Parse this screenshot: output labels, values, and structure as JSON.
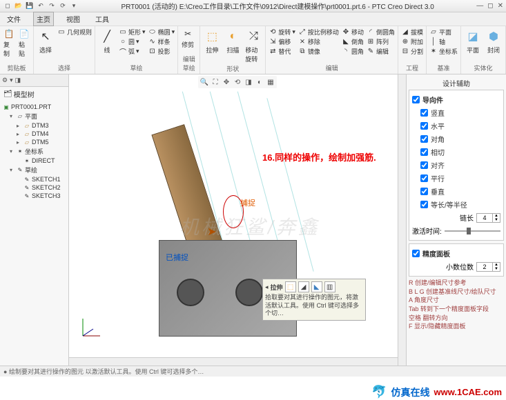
{
  "titlebar": {
    "title": "PRT0001 (活动的) E:\\Creo工作目录\\工作文件\\0912\\Direct建模操作\\prt0001.prt.6 - PTC Creo Direct 3.0"
  },
  "menubar": {
    "items": [
      "文件",
      "主页",
      "视图",
      "工具"
    ],
    "active_index": 1
  },
  "ribbon": {
    "groups": [
      {
        "label": "剪贴板",
        "items": [
          "复制",
          "粘贴"
        ]
      },
      {
        "label": "选择",
        "items": [
          "选择",
          "几何规则"
        ]
      },
      {
        "label": "草绘",
        "items": [
          {
            "col": [
              "矩形",
              "圆",
              "线",
              "弧"
            ]
          },
          {
            "col": [
              "椭圆",
              "样条",
              "投影"
            ]
          }
        ]
      },
      {
        "label": "编辑草绘",
        "items": [
          "修剪"
        ]
      },
      {
        "label": "形状",
        "items": [
          "拉伸",
          "扫描",
          "移动旋转"
        ]
      },
      {
        "label": "编辑",
        "items": [
          {
            "col": [
              "旋转",
              "偏移",
              "替代"
            ]
          },
          {
            "col": [
              "按比例移动",
              "移除",
              "镜像"
            ]
          },
          {
            "col": [
              "移动",
              "倒角",
              "圆角"
            ]
          },
          {
            "col": [
              "倒圆角",
              "阵列",
              "编辑"
            ]
          }
        ]
      },
      {
        "label": "工程",
        "items": [
          "拔模",
          "附加",
          "分割"
        ]
      },
      {
        "label": "基准",
        "items": [
          "平面",
          "轴",
          "坐标系"
        ]
      },
      {
        "label": "实体化",
        "items": [
          "平面",
          "封闭"
        ]
      }
    ]
  },
  "tree": {
    "title": "模型树",
    "root": "PRT0001.PRT",
    "nodes": [
      {
        "label": "平面",
        "expanded": true,
        "children": [
          "DTM3",
          "DTM4",
          "DTM5"
        ]
      },
      {
        "label": "坐标系",
        "expanded": true,
        "children": [
          "DIRECT"
        ]
      },
      {
        "label": "草绘",
        "expanded": true,
        "children": [
          "SKETCH1",
          "SKETCH2",
          "SKETCH3"
        ]
      }
    ]
  },
  "viewport": {
    "annotation_text": "16.同样的操作，绘制加强筋.",
    "snap_label_1": "捕捉",
    "snap_label_2": "已捕捉",
    "watermark": "机械狂鲨/奔鑫",
    "popup": {
      "title": "拉伸",
      "body": "拾取要对其进行操作的图元，将激活默认工具。使用 Ctrl 键可选择多个切…"
    }
  },
  "side_panel": {
    "title": "设计辅助",
    "guide_section": {
      "header": "导向件",
      "checks": [
        "竖直",
        "水平",
        "对角",
        "相切",
        "对齐",
        "平行",
        "垂直",
        "等长/等半径"
      ],
      "chain_label": "链长",
      "chain_value": "4",
      "activate_label": "激活时间:"
    },
    "precision_section": {
      "header": "精度面板",
      "decimal_label": "小数位数",
      "decimal_value": "2"
    },
    "hints": [
      "R 创建/编辑尺寸参考",
      "B L G 创建基准线尺寸/绘队尺寸",
      "A 角度尺寸",
      "Tab 转到下一个精度面板字段",
      "空格 翻转方向",
      "F 显示/隐藏精度面板"
    ]
  },
  "statusbar": {
    "hint": "绘制要对其进行操作的图元 以激活默认工具。使用 Ctrl 键可选择多个…"
  },
  "footer": {
    "brand": "仿真在线",
    "url": "www.1CAE.com"
  }
}
